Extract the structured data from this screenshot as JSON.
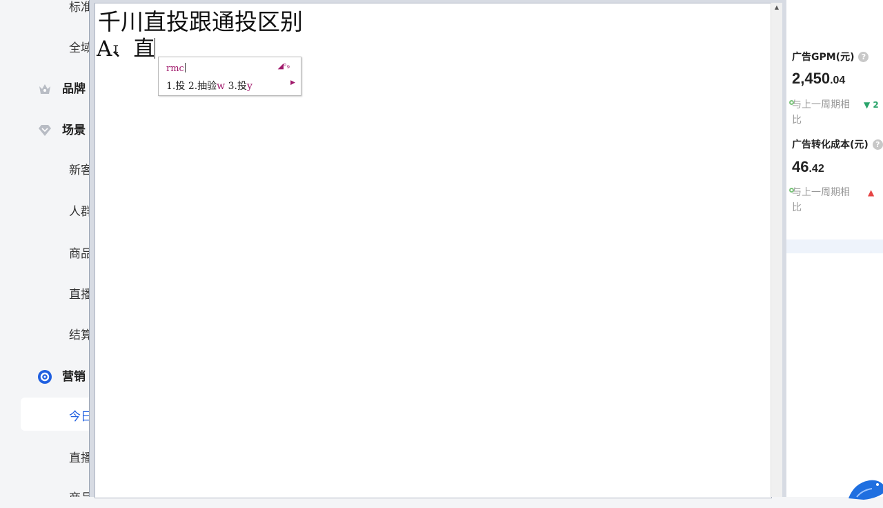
{
  "sidebar": {
    "items": [
      {
        "label": "标准",
        "type": "item",
        "icon": ""
      },
      {
        "label": "全域",
        "type": "item",
        "icon": ""
      },
      {
        "label": "品牌",
        "type": "group",
        "icon": "crown-icon"
      },
      {
        "label": "场景",
        "type": "group",
        "icon": "diamond-icon"
      },
      {
        "label": "新客",
        "type": "item",
        "icon": ""
      },
      {
        "label": "人群",
        "type": "item",
        "icon": ""
      },
      {
        "label": "商品",
        "type": "item",
        "icon": ""
      },
      {
        "label": "直播",
        "type": "item",
        "icon": ""
      },
      {
        "label": "结算",
        "type": "item",
        "icon": ""
      },
      {
        "label": "营销",
        "type": "group",
        "icon": "compass-icon"
      },
      {
        "label": "今日",
        "type": "item",
        "icon": "",
        "active": true
      },
      {
        "label": "直播",
        "type": "item",
        "icon": ""
      },
      {
        "label": "商品",
        "type": "item",
        "icon": ""
      }
    ]
  },
  "editor": {
    "line1": "千川直投跟通投区别",
    "line2": "A、直"
  },
  "ime": {
    "composition": "rmc",
    "candidates": [
      {
        "index": "1.",
        "text": "投"
      },
      {
        "index": "2.",
        "text": "抽验",
        "suffix": "w"
      },
      {
        "index": "3.",
        "text": "投",
        "suffix": "y"
      }
    ]
  },
  "right_panel": {
    "metrics": [
      {
        "label": "广告GPM(元)",
        "value_int": "2,450",
        "value_dec": ".04",
        "compare": "与上一周期相比",
        "trend": "down",
        "trend_text": "2"
      },
      {
        "label": "广告转化成本(元)",
        "value_int": "46",
        "value_dec": ".42",
        "compare": "与上一周期相比",
        "trend": "up",
        "trend_text": ""
      }
    ]
  },
  "colors": {
    "accent": "#1f5fe0",
    "ime_highlight": "#a0196b",
    "trend_down": "#2aa46b",
    "trend_up": "#e64545"
  }
}
